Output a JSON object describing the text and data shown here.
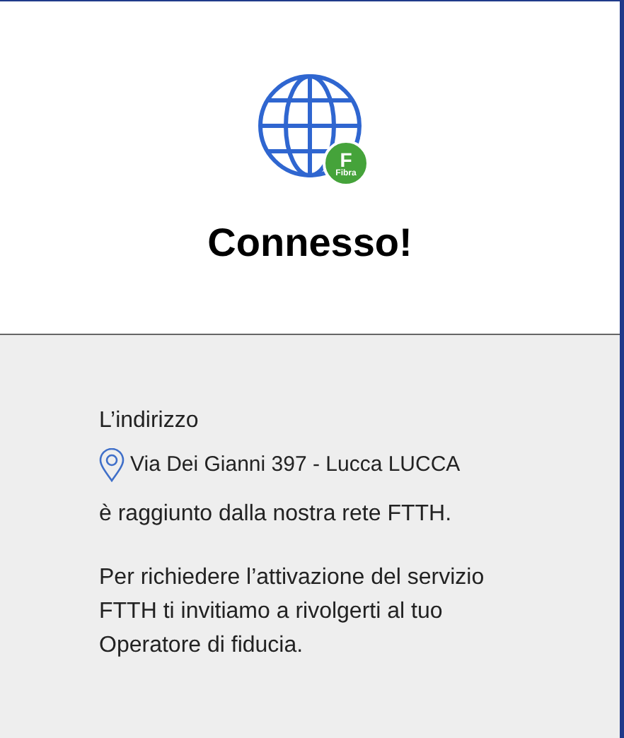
{
  "badge": {
    "letter": "F",
    "label": "Fibra"
  },
  "title": "Connesso!",
  "address_label": "L’indirizzo",
  "address": "Via Dei Gianni 397 - Lucca LUCCA",
  "reach_text": "è raggiunto dalla nostra rete FTTH.",
  "info_text": "Per richiedere l’attivazione del servizio FTTH ti invitiamo a rivolgerti al tuo Operatore di fiducia."
}
